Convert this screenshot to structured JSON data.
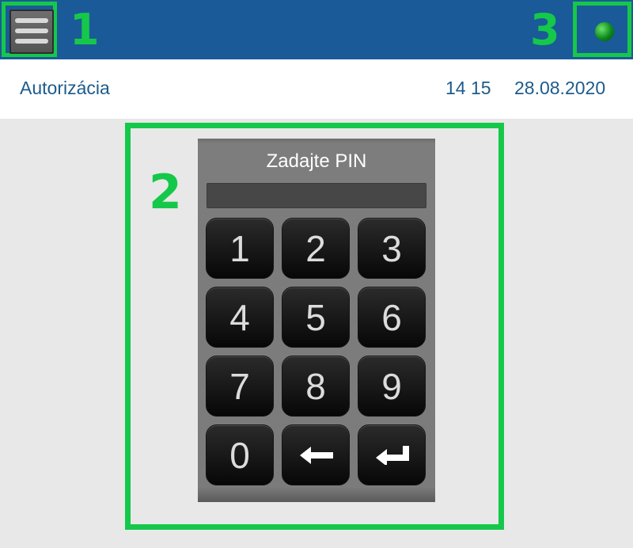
{
  "header": {
    "label_menu": "1",
    "label_status": "3"
  },
  "subheader": {
    "title": "Autorizácia",
    "time": "14 15",
    "date": "28.08.2020"
  },
  "pin_panel": {
    "label": "2",
    "title": "Zadajte PIN",
    "pin_value": "",
    "keys": [
      "1",
      "2",
      "3",
      "4",
      "5",
      "6",
      "7",
      "8",
      "9",
      "0",
      "backspace-icon",
      "enter-icon"
    ]
  },
  "colors": {
    "topbar": "#1b5a98",
    "highlight": "#15c84a",
    "status_dot": "#0c8a1c",
    "subbar_text": "#1d5b8c"
  }
}
